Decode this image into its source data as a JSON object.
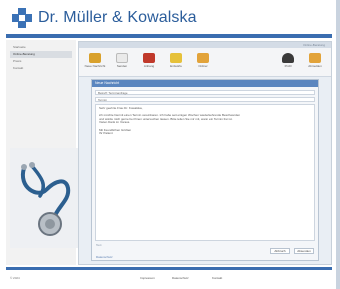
{
  "brand": {
    "title": "Dr. Müller & Kowalska"
  },
  "sidebar": {
    "items": [
      {
        "label": "Startseite"
      },
      {
        "label": "Online-Beratung"
      },
      {
        "label": "Praxis"
      },
      {
        "label": "Kontakt"
      }
    ],
    "active_index": 1
  },
  "app": {
    "title": "Online-Beratung",
    "toolbar": [
      {
        "label": "Neue Nachricht",
        "icon": "new-message-icon",
        "color": "#d9a12c"
      },
      {
        "label": "Senden",
        "icon": "send-icon",
        "color": "#e7e7e7"
      },
      {
        "label": "Anhang",
        "icon": "attach-icon",
        "color": "#c0392b"
      },
      {
        "label": "Entwürfe",
        "icon": "drafts-icon",
        "color": "#e6c13a"
      },
      {
        "label": "Ordner",
        "icon": "folder-icon",
        "color": "#e2a33a"
      }
    ],
    "toolbar_right": [
      {
        "label": "Profil",
        "icon": "profile-icon",
        "color": "#3a3a3a"
      },
      {
        "label": "Abmelden",
        "icon": "logout-icon",
        "color": "#e2a33a"
      }
    ]
  },
  "dialog": {
    "title": "Neue Nachricht",
    "to_field": "Betreff: Terminanfrage",
    "subject_field": "Termin",
    "body_lines": [
      "Sehr geehrte Frau Dr. Kowalska,",
      "",
      "ich möchte hiermit einen Termin vereinbaren. Ich habe seit einigen Wochen wiederkehrende Beschwerden",
      "und würde mich gerne bei Ihnen untersuchen lassen. Bitte teilen Sie mir mit, wann ein Termin frei ist.",
      "Vielen Dank im Voraus.",
      "",
      "Mit freundlichen Grüßen",
      "Ihr Patient"
    ],
    "hint": "Text",
    "buttons": {
      "cancel": "Abbruch",
      "send": "Absenden"
    },
    "link": "Datenschutz"
  },
  "footer": {
    "copyright": "© 2024",
    "links": [
      "Impressum",
      "Datenschutz",
      "Kontakt"
    ]
  },
  "colors": {
    "accent": "#3a6db0",
    "brand": "#2b5d9b",
    "dialog_title": "#5b86bf"
  }
}
